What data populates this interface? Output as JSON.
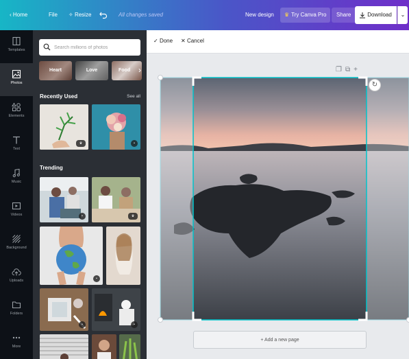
{
  "topbar": {
    "home": "Home",
    "file": "File",
    "resize": "Resize",
    "status": "All changes saved",
    "new_design": "New design",
    "try_pro": "Try Canva Pro",
    "share": "Share",
    "download": "Download",
    "brand_gradient": [
      "#17b6c6",
      "#4a56c8",
      "#6f2fc9"
    ]
  },
  "rail": [
    {
      "label": "Templates",
      "icon": "templates-icon"
    },
    {
      "label": "Photos",
      "icon": "photos-icon",
      "active": true
    },
    {
      "label": "Elements",
      "icon": "elements-icon"
    },
    {
      "label": "Text",
      "icon": "text-icon"
    },
    {
      "label": "Music",
      "icon": "music-icon"
    },
    {
      "label": "Videos",
      "icon": "videos-icon"
    },
    {
      "label": "Background",
      "icon": "background-icon"
    },
    {
      "label": "Uploads",
      "icon": "uploads-icon"
    },
    {
      "label": "Folders",
      "icon": "folders-icon"
    },
    {
      "label": "More",
      "icon": "more-icon"
    }
  ],
  "panel": {
    "search_placeholder": "Search millions of photos",
    "chips": [
      "Heart",
      "Love",
      "Food"
    ],
    "recently_used": "Recently Used",
    "see_all": "See all",
    "trending": "Trending"
  },
  "editor": {
    "done": "Done",
    "cancel": "Cancel",
    "add_page": "+ Add a new page"
  }
}
